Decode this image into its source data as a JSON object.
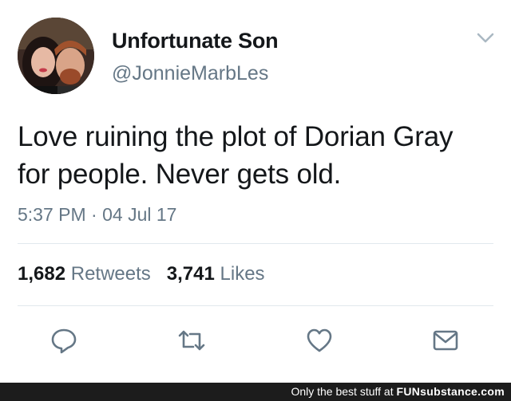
{
  "user": {
    "display_name": "Unfortunate Son",
    "handle": "@JonnieMarbLes"
  },
  "tweet": {
    "text": "Love ruining the plot of Dorian Gray for people. Never gets old.",
    "time": "5:37 PM",
    "separator": "·",
    "date": "04 Jul 17"
  },
  "stats": {
    "retweets_count": "1,682",
    "retweets_label": "Retweets",
    "likes_count": "3,741",
    "likes_label": "Likes"
  },
  "actions": {
    "icons": [
      "reply-icon",
      "retweet-icon",
      "like-icon",
      "message-icon"
    ]
  },
  "footer": {
    "text": "Only the best stuff at",
    "brand": "FUNsubstance.com"
  },
  "colors": {
    "text": "#14171a",
    "secondary": "#657786",
    "divider": "#e1e8ed",
    "footer_bg": "#1c1c1c"
  }
}
